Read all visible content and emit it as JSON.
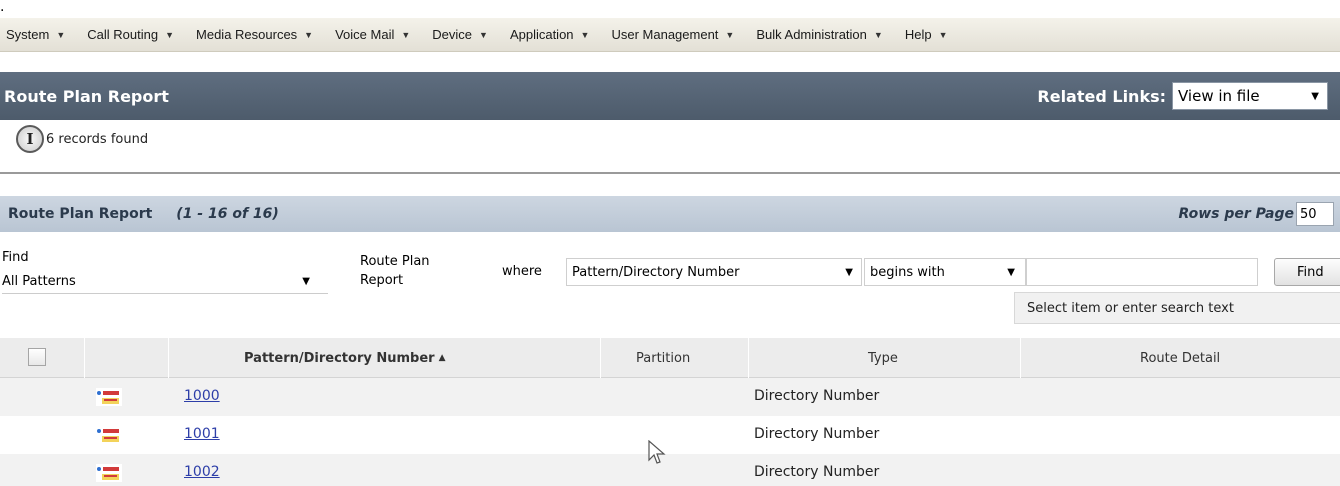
{
  "menu": [
    {
      "label": "System"
    },
    {
      "label": "Call Routing"
    },
    {
      "label": "Media Resources"
    },
    {
      "label": "Voice Mail"
    },
    {
      "label": "Device"
    },
    {
      "label": "Application"
    },
    {
      "label": "User Management"
    },
    {
      "label": "Bulk Administration"
    },
    {
      "label": "Help"
    }
  ],
  "header": {
    "title": "Route Plan Report",
    "related_label": "Related Links:",
    "related_value": "View in file"
  },
  "status": {
    "icon_letter": "I",
    "text": "6 records found"
  },
  "section": {
    "title": "Route Plan Report",
    "count": "(1 - 16 of 16)",
    "rows_label": "Rows per Page",
    "rows_value": "50"
  },
  "search": {
    "find_label": "Find",
    "find_value": "All Patterns",
    "report_label": "Route Plan Report",
    "where_label": "where",
    "field_value": "Pattern/Directory Number",
    "operator_value": "begins with",
    "input_value": "",
    "button_label": "Find",
    "hint": "Select item or enter search text"
  },
  "table": {
    "columns": {
      "pattern": "Pattern/Directory Number",
      "partition": "Partition",
      "type": "Type",
      "route_detail": "Route Detail"
    },
    "rows": [
      {
        "pattern": "1000",
        "partition": "",
        "type": "Directory Number",
        "route_detail": ""
      },
      {
        "pattern": "1001",
        "partition": "",
        "type": "Directory Number",
        "route_detail": ""
      },
      {
        "pattern": "1002",
        "partition": "",
        "type": "Directory Number",
        "route_detail": ""
      }
    ]
  },
  "icons": {
    "row_icon": "directory-number-icon",
    "info": "info-icon",
    "cursor": "mouse-cursor-icon"
  }
}
